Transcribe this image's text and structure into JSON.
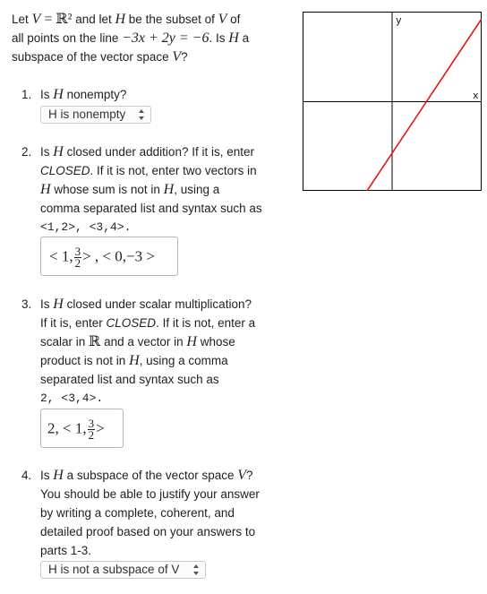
{
  "intro": {
    "line1_a": "Let ",
    "V": "V",
    "eq": " = ",
    "R2": "ℝ²",
    "line1_b": " and let ",
    "H": "H",
    "line1_c": " be the subset of ",
    "line1_d": " of",
    "line2_a": "all points on the line ",
    "line_eq": "−3x + 2y = −6",
    "line2_b": ". Is ",
    "line2_c": " a",
    "line3": "subspace of the vector space ",
    "line3_end": "?"
  },
  "q1": {
    "number": "1.",
    "text_a": "Is ",
    "text_b": " nonempty?",
    "select_value": "H is nonempty"
  },
  "q2": {
    "number": "2.",
    "l1_a": "Is ",
    "l1_b": " closed under addition? If it is, enter",
    "l2_a": "CLOSED",
    "l2_b": ". If it is not, enter two vectors in",
    "l3_b": " whose sum is not in ",
    "l3_c": ", using a",
    "l4": "comma separated list and syntax such as",
    "l5": "<1,2>, <3,4>.",
    "answer_prefix": "< 1,",
    "answer_num": "3",
    "answer_den": "2",
    "answer_suffix": "> , < 0,−3 >"
  },
  "q3": {
    "number": "3.",
    "l1_a": "Is ",
    "l1_b": " closed under scalar multiplication?",
    "l2_a": "If it is, enter ",
    "l2_b": "CLOSED",
    "l2_c": ". If it is not, enter a",
    "l3_a": "scalar in ",
    "R": "ℝ",
    "l3_b": " and a vector in ",
    "l3_c": " whose",
    "l4_a": "product is not in ",
    "l4_b": ", using a comma",
    "l5": "separated list and syntax such as",
    "l6": "2, <3,4>.",
    "answer_prefix": "2, < 1,",
    "answer_num": "3",
    "answer_den": "2",
    "answer_suffix": ">"
  },
  "q4": {
    "number": "4.",
    "l1_a": "Is ",
    "l1_b": " a subspace of the vector space ",
    "l1_c": "?",
    "l2": "You should be able to justify your answer",
    "l3": "by writing a complete, coherent, and",
    "l4": "detailed proof based on your answers to",
    "l5": "parts 1-3.",
    "select_value": "H is not a subspace of V"
  },
  "graph": {
    "x_label": "x",
    "y_label": "y",
    "line_color": "#e8141b",
    "axis_color": "#000000"
  }
}
